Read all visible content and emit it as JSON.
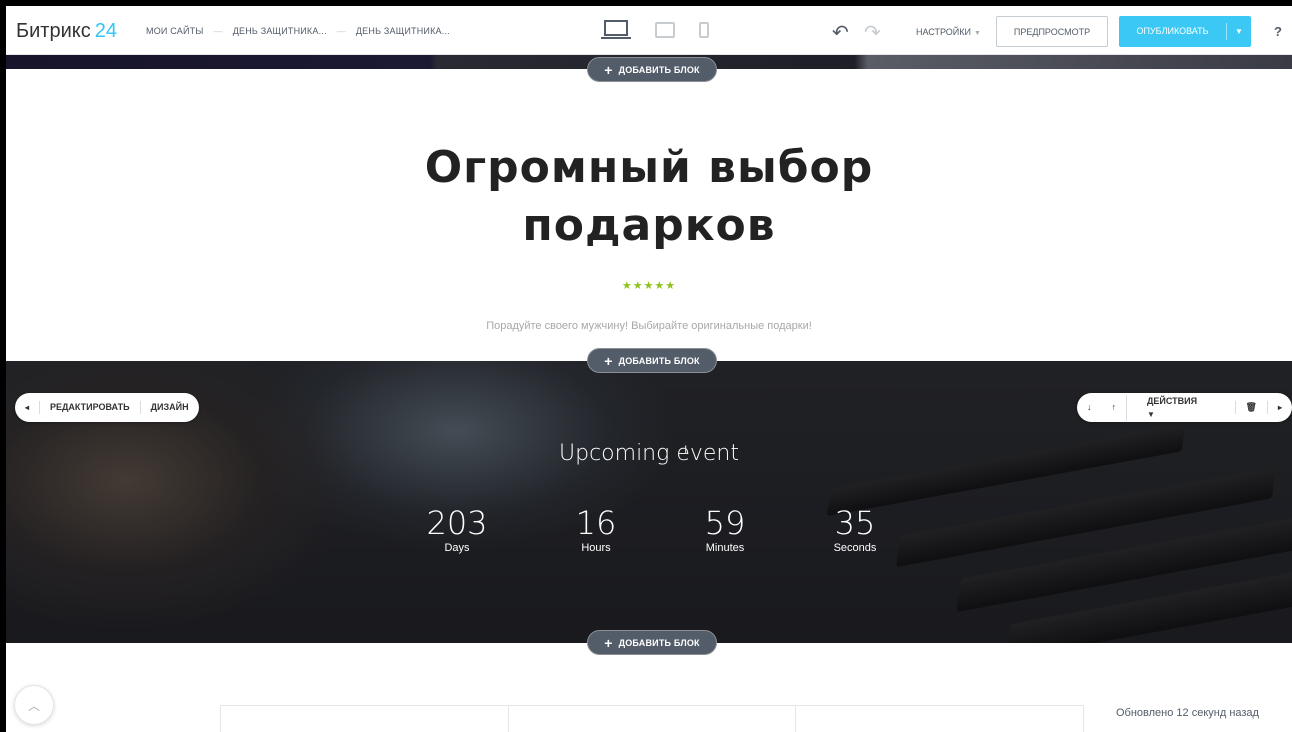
{
  "topbar": {
    "logo_text": "Битрикс",
    "logo_num": "24",
    "breadcrumbs": [
      "МОИ САЙТЫ",
      "ДЕНЬ ЗАЩИТНИКА...",
      "ДЕНЬ ЗАЩИТНИКА..."
    ],
    "breadcrumb_sep": "—",
    "undo_icon": "↶",
    "redo_icon": "↷",
    "settings_label": "НАСТРОЙКИ",
    "preview_label": "ПРЕДПРОСМОТР",
    "publish_label": "ОПУБЛИКОВАТЬ",
    "help_label": "?"
  },
  "add_block_label": "ДОБАВИТЬ БЛОК",
  "hero": {
    "title_line1": "Огромный выбор",
    "title_line2": "подарков",
    "stars": "★★★★★",
    "subtitle": "Порадуйте своего мужчину! Выбирайте оригинальные подарки!"
  },
  "block_toolbar": {
    "edit_label": "РЕДАКТИРОВАТЬ",
    "design_label": "ДИЗАЙН",
    "actions_label": "ДЕЙСТВИЯ"
  },
  "event": {
    "title": "Upcoming event",
    "countdown": [
      {
        "value": "203",
        "unit": "Days"
      },
      {
        "value": "16",
        "unit": "Hours"
      },
      {
        "value": "59",
        "unit": "Minutes"
      },
      {
        "value": "35",
        "unit": "Seconds"
      }
    ]
  },
  "status": {
    "updated_text": "Обновлено 12 секунд назад"
  }
}
